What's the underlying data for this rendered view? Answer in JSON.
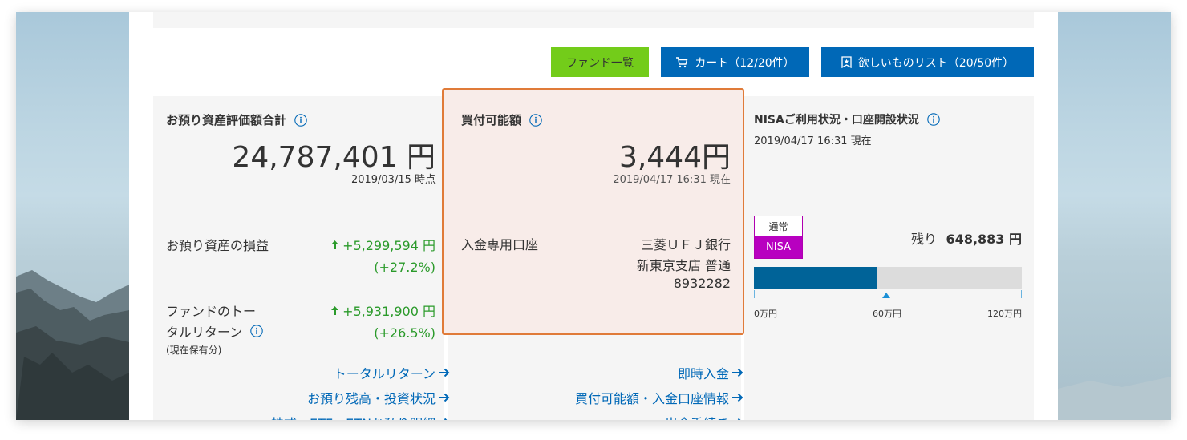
{
  "colors": {
    "link": "#0068b7",
    "fund_button": "#73cc1a",
    "gain_green": "#2a9a2a",
    "highlight_border": "#e07b39",
    "nisa_purple": "#b800c0",
    "bar_fill": "#006398"
  },
  "buttons": {
    "fund_list": "ファンド一覧",
    "cart": "カート（12/20件）",
    "wishlist": "欲しいものリスト（20/50件）"
  },
  "assets": {
    "title": "お預り資産評価額合計",
    "total": "24,787,401 円",
    "as_of": "2019/03/15 時点",
    "pl_label": "お預り資産の損益",
    "pl_value": "+5,299,594 円",
    "pl_pct": "(+27.2%)",
    "tr_label_1": "ファンドのトー",
    "tr_label_2": "タルリターン",
    "tr_note": "(現在保有分)",
    "tr_value": "+5,931,900 円",
    "tr_pct": "(+26.5%)",
    "links": [
      "トータルリターン",
      "お預り残高・投資状況",
      "株式・ETF・ETNお預り明細"
    ]
  },
  "buying_power": {
    "title": "買付可能額",
    "amount": "3,444円",
    "as_of": "2019/04/17 16:31 現在",
    "deposit_label": "入金専用口座",
    "bank": "三菱ＵＦＪ銀行",
    "branch": "新東京支店 普通",
    "account": "8932282",
    "links": [
      "即時入金",
      "買付可能額・入金口座情報",
      "出金手続き"
    ]
  },
  "nisa": {
    "title": "NISAご利用状況・口座開設状況",
    "as_of": "2019/04/17 16:31 現在",
    "badge_top": "通常",
    "badge_bottom": "NISA",
    "remaining_label": "残り",
    "remaining_value": "648,883 円",
    "used_fraction": 0.459,
    "marker_fraction": 0.494,
    "axis": [
      "0万円",
      "60万円",
      "120万円"
    ]
  }
}
